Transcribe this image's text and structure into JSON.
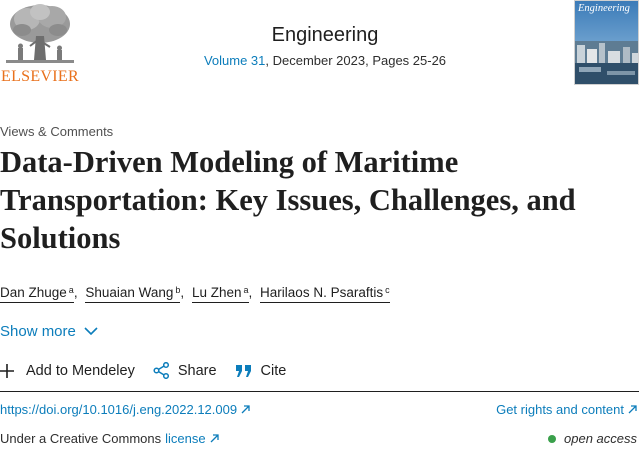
{
  "publisher": {
    "logo_text": "ELSEVIER"
  },
  "journal": {
    "title": "Engineering",
    "volume_link": "Volume 31",
    "issue_details": ", December 2023, Pages 25-26",
    "cover_text": "Engineering"
  },
  "article": {
    "type": "Views & Comments",
    "title": "Data-Driven Modeling of Maritime Transportation: Key Issues, Challenges, and Solutions",
    "authors": [
      {
        "name": "Dan Zhuge",
        "sup": "a"
      },
      {
        "name": "Shuaian Wang",
        "sup": "b"
      },
      {
        "name": "Lu Zhen",
        "sup": "a"
      },
      {
        "name": "Harilaos N. Psaraftis",
        "sup": "c"
      }
    ],
    "author_separator": ","
  },
  "show_more": {
    "label": "Show more"
  },
  "actions": {
    "mendeley": "Add to Mendeley",
    "share": "Share",
    "cite": "Cite"
  },
  "links": {
    "doi": "https://doi.org/10.1016/j.eng.2022.12.009",
    "rights": "Get rights and content"
  },
  "license": {
    "prefix": "Under a Creative Commons",
    "link": "license",
    "access": "open access"
  },
  "colors": {
    "link": "#0c7dbb",
    "elsevier_orange": "#e9711c",
    "open_access_dot": "#3aa04b",
    "text": "#1f1f1f"
  }
}
